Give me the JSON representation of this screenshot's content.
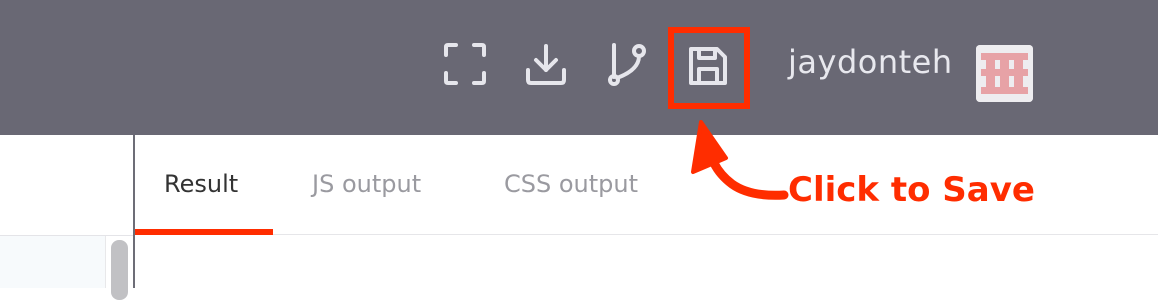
{
  "toolbar": {
    "background": "#696874",
    "icons": [
      "fullscreen-icon",
      "download-icon",
      "fork-icon",
      "save-icon"
    ],
    "username": "jaydonteh"
  },
  "tabs": [
    {
      "label": "Result",
      "active": true
    },
    {
      "label": "JS output",
      "active": false
    },
    {
      "label": "CSS output",
      "active": false
    }
  ],
  "annotation": {
    "text": "Click to Save",
    "color": "#ff2d00"
  }
}
